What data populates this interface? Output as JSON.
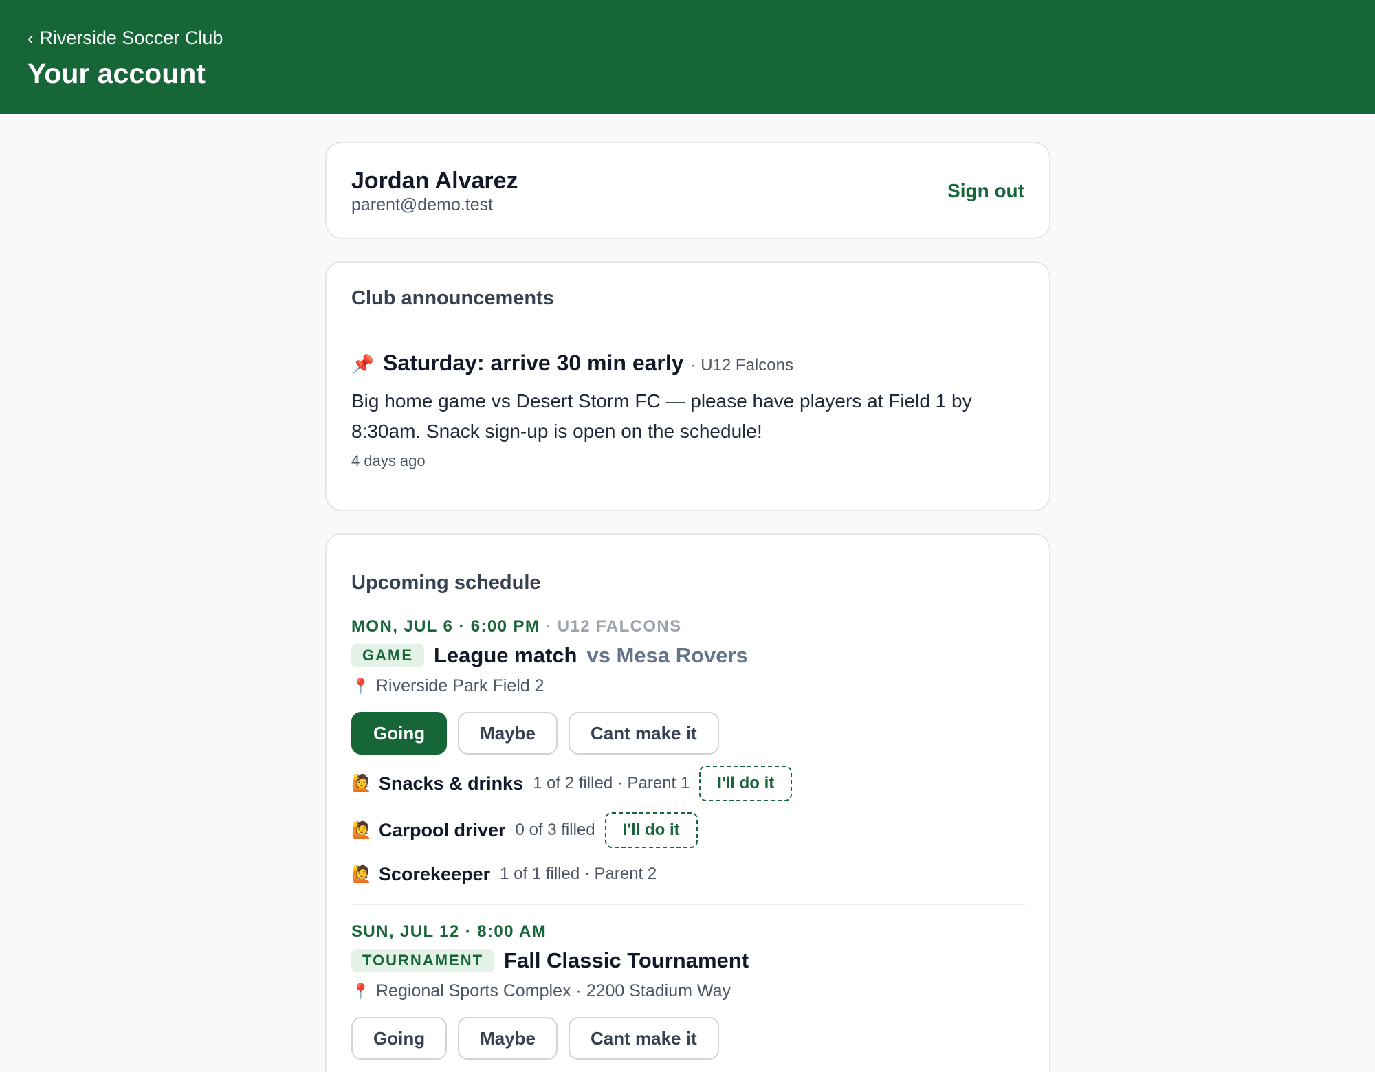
{
  "header": {
    "back_label": "Riverside Soccer Club",
    "title": "Your account"
  },
  "account": {
    "name": "Jordan Alvarez",
    "email": "parent@demo.test",
    "sign_out_label": "Sign out"
  },
  "announcements": {
    "section_title": "Club announcements",
    "items": [
      {
        "icon": "pushpin-icon",
        "title": "Saturday: arrive 30 min early",
        "team": "· U12 Falcons",
        "body": "Big home game vs Desert Storm FC — please have players at Field 1 by 8:30am. Snack sign-up is open on the schedule!",
        "time": "4 days ago"
      }
    ]
  },
  "schedule": {
    "section_title": "Upcoming schedule",
    "events": [
      {
        "date": "MON, JUL 6 · 6:00 PM",
        "team": " · U12 FALCONS",
        "badge": "GAME",
        "title": "League match",
        "opponent": "vs Mesa Rovers",
        "location": "Riverside Park Field 2",
        "rsvp": {
          "going": "Going",
          "maybe": "Maybe",
          "cant": "Cant make it",
          "selected": "going"
        },
        "slots": [
          {
            "name": "Snacks & drinks",
            "meta": "1 of 2 filled · Parent 1",
            "claim": "I'll do it"
          },
          {
            "name": "Carpool driver",
            "meta": "0 of 3 filled",
            "claim": "I'll do it"
          },
          {
            "name": "Scorekeeper",
            "meta": "1 of 1 filled · Parent 2"
          }
        ]
      },
      {
        "date": "SUN, JUL 12 · 8:00 AM",
        "badge": "TOURNAMENT",
        "title": "Fall Classic Tournament",
        "location": "Regional Sports Complex · 2200 Stadium Way",
        "rsvp": {
          "going": "Going",
          "maybe": "Maybe",
          "cant": "Cant make it",
          "selected": "none"
        }
      }
    ]
  },
  "colors": {
    "brand": "#176638",
    "badge_bg": "#e3f1e7",
    "pin": "#dc2626"
  }
}
